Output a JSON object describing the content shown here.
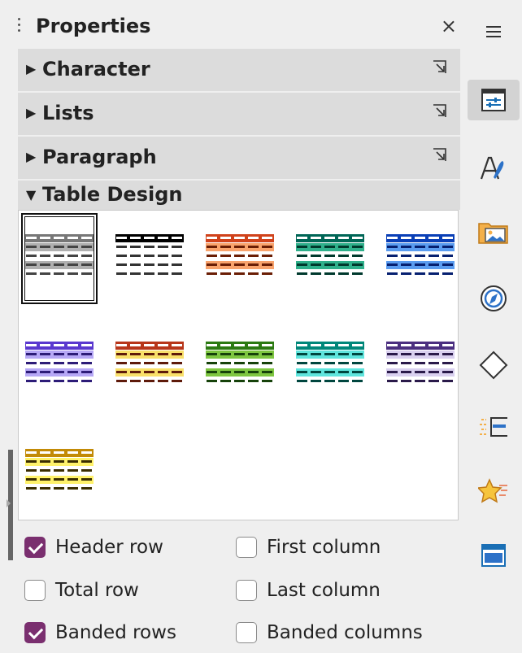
{
  "header": {
    "title": "Properties",
    "close_glyph": "×"
  },
  "sections": [
    {
      "label": "Character",
      "expanded": false
    },
    {
      "label": "Lists",
      "expanded": false
    },
    {
      "label": "Paragraph",
      "expanded": false
    },
    {
      "label": "Table Design",
      "expanded": true
    }
  ],
  "table_styles": [
    {
      "name": "default",
      "header": "#777777",
      "band": "#b0b0b0",
      "rule": "#444444",
      "selected": true
    },
    {
      "name": "black",
      "header": "#000000",
      "band": "#ffffff",
      "rule": "#333333",
      "selected": false
    },
    {
      "name": "orange-red",
      "header": "#d0421b",
      "band": "#f9a36c",
      "rule": "#6a1e05",
      "selected": false
    },
    {
      "name": "teal",
      "header": "#006656",
      "band": "#2fb08b",
      "rule": "#00392d",
      "selected": false
    },
    {
      "name": "blue",
      "header": "#0a3fb6",
      "band": "#5a9cf0",
      "rule": "#062070",
      "selected": false
    },
    {
      "name": "violet",
      "header": "#5a38cf",
      "band": "#b6a8f6",
      "rule": "#2d1c78",
      "selected": false
    },
    {
      "name": "red-yellow",
      "header": "#b8361a",
      "band": "#f9e06a",
      "rule": "#5e1a0a",
      "selected": false
    },
    {
      "name": "green",
      "header": "#2c7a12",
      "band": "#7ec640",
      "rule": "#16420a",
      "selected": false
    },
    {
      "name": "cyan",
      "header": "#00877a",
      "band": "#5fe5dd",
      "rule": "#00463f",
      "selected": false
    },
    {
      "name": "lavender",
      "header": "#4b2f80",
      "band": "#d9d0ef",
      "rule": "#2a1a4a",
      "selected": false
    },
    {
      "name": "yellow",
      "header": "#c28a06",
      "band": "#fff26a",
      "rule": "#3a2d00",
      "selected": false
    }
  ],
  "options": [
    {
      "label": "Header row",
      "checked": true
    },
    {
      "label": "First column",
      "checked": false
    },
    {
      "label": "Total row",
      "checked": false
    },
    {
      "label": "Last column",
      "checked": false
    },
    {
      "label": "Banded rows",
      "checked": true
    },
    {
      "label": "Banded columns",
      "checked": false
    }
  ],
  "sidebar_icons": [
    "menu-icon",
    "properties-icon",
    "styles-icon",
    "gallery-icon",
    "navigator-icon",
    "shapes-icon",
    "page-icon",
    "style-inspector-icon",
    "manage-changes-icon"
  ],
  "colors": {
    "accent": "#7a2f6f",
    "active_tab": "#d3d3d3",
    "section_bg": "#dcdcdc"
  }
}
